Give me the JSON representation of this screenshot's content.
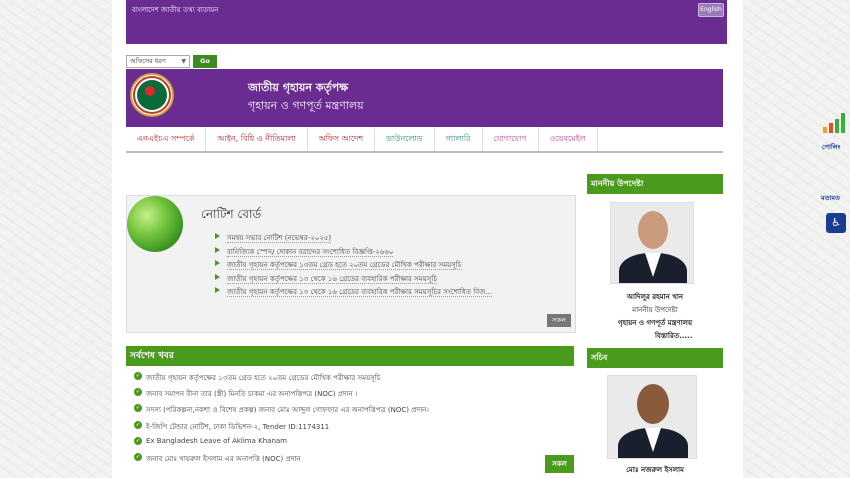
{
  "topbar": {
    "text": "বাংলাদেশ জাতীয় তথ্য বাতায়ন",
    "lang_button": "English"
  },
  "office_select": {
    "value": "অফিসের ধরণ",
    "go_button": "Go"
  },
  "banner": {
    "title": "জাতীয় গৃহায়ন কর্তৃপক্ষ",
    "subtitle": "গৃহায়ন ও গণপূর্ত মন্ত্রণালয়"
  },
  "nav": [
    "এনএইচএ সম্পর্কে",
    "আইন, বিধি ও নীতিমালা",
    "অফিস আদেশ",
    "ডাউনলোড",
    "গ্যালারি",
    "যোগাযোগ",
    "ওয়েবমেইল"
  ],
  "notice_board": {
    "title": "নোটিশ বোর্ড",
    "items": [
      "সমন্বয় সভার নোটিশ (নভেম্বর-২০২৫)",
      "বানিজ্যিক স্পেস/ দোকান বরাদ্দের সংশোধিত বিজ্ঞপ্তি-২৬৬০",
      "জাতীয় গৃহায়ন কর্তৃপক্ষের ১৩তম গ্রেড হতে ২০তম গ্রেডের মৌখিক পরীক্ষার সময়সূচি",
      "জাতীয় গৃহায়ন কর্তৃপক্ষের ১৩ থেকে ১৬ গ্রেডের ব্যবহারিক পরীক্ষার সময়সূচি",
      "জাতীয় গৃহায়ন কর্তৃপক্ষের ১৩ থেকে ১৬ গ্রেডের ব্যবহারিক পরীক্ষার সময়সূচির সংশোধিত বিজ..."
    ],
    "all_button": "সকল"
  },
  "news": {
    "title": "সর্বশেষ খবর",
    "items": [
      "জাতীয় গৃহায়ন কর্তৃপক্ষের ১৩তম গ্রেড হতে ২০তম গ্রেডের মৌখিক পরীক্ষার সময়সূচি",
      "জনাব সমাপন বীনা তার (স্ত্রী) মিনতি চাকমা এর অনাপত্তিপত্র (NOC) প্রদান ।",
      "সদস্য (পরিকল্পনা,নকশা ও বিশেষ প্রকল্প) জনাব মোঃ আব্দুল গোফফার এর অনাপত্তিপত্র (NOC) প্রদান।",
      "ই-জিপি টেন্ডার নোটিশ, ঢাকা ডিভিশন-২, Tender ID:1174311",
      "Ex Bangladesh Leave of Aklima Khanam",
      "জনাব মোঃ খায়রুল ইসলাম এর অনাপত্তি (NOC) প্রদান"
    ],
    "all_button": "সকল"
  },
  "sidebar": {
    "advisor_heading": "মাননীয় উপদেষ্টা",
    "advisor_name": "আদিলুর রহমান খান",
    "advisor_role": "মাননীয় উপদেষ্টা",
    "advisor_ministry": "গৃহায়ন ও গণপূর্ত মন্ত্রণালয়",
    "details_link": "বিস্তারিত.....",
    "secretary_heading": "সচিব",
    "secretary_name": "মোঃ নজরুল ইসলাম"
  },
  "right_tools": {
    "poll_label": "পোলিং",
    "opinion_label": "মতামত"
  },
  "colors": {
    "purple": "#6a2c91",
    "green": "#4a9a1e",
    "nav_red": "#c03030"
  }
}
